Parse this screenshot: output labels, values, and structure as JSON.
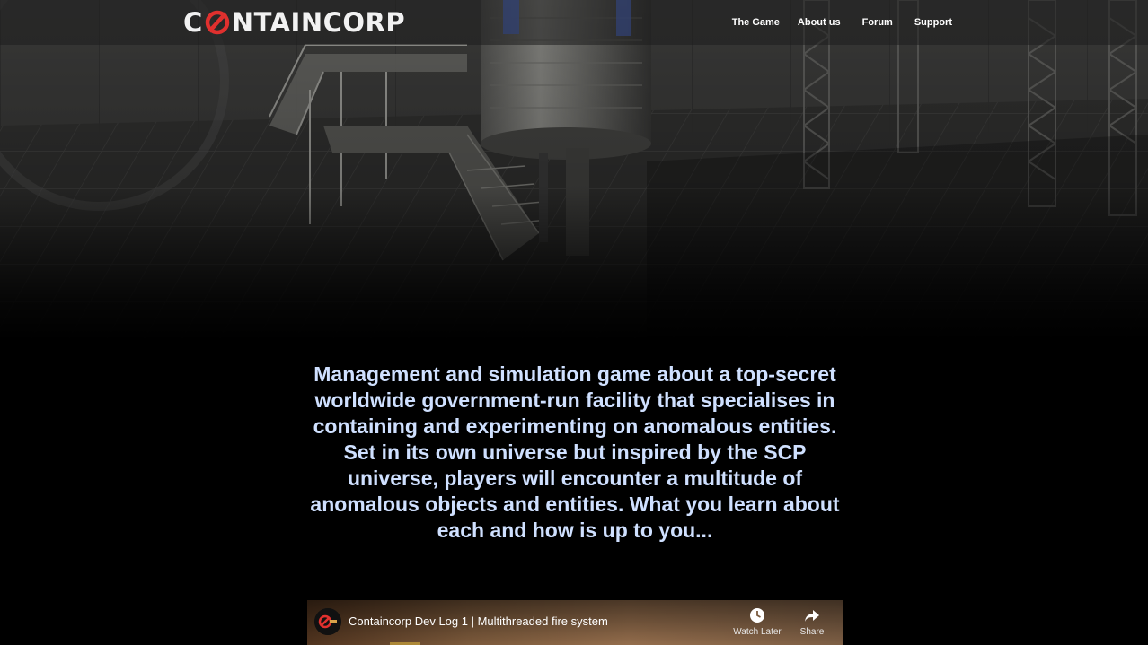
{
  "header": {
    "logo_text": "NTAINCORP",
    "logo_initial": "C",
    "brand_accent": "#e0302e"
  },
  "nav": {
    "items": [
      {
        "label": "The Game"
      },
      {
        "label": "About us"
      },
      {
        "label": "Forum"
      },
      {
        "label": "Support"
      }
    ]
  },
  "main": {
    "description": "Management and simulation game about a top-secret worldwide government-run facility that specialises in containing and experimenting on anomalous entities. Set in its own universe but inspired by the SCP universe, players will encounter a multitude of anomalous objects and entities. What you learn about each and how is up to you..."
  },
  "video": {
    "title": "Containcorp Dev Log 1 | Multithreaded fire system",
    "watch_later_label": "Watch Later",
    "share_label": "Share",
    "watch_later_icon": "clock-icon",
    "share_icon": "share-arrow-icon"
  },
  "colors": {
    "text_accent": "#cfe0ff",
    "background": "#000000"
  }
}
